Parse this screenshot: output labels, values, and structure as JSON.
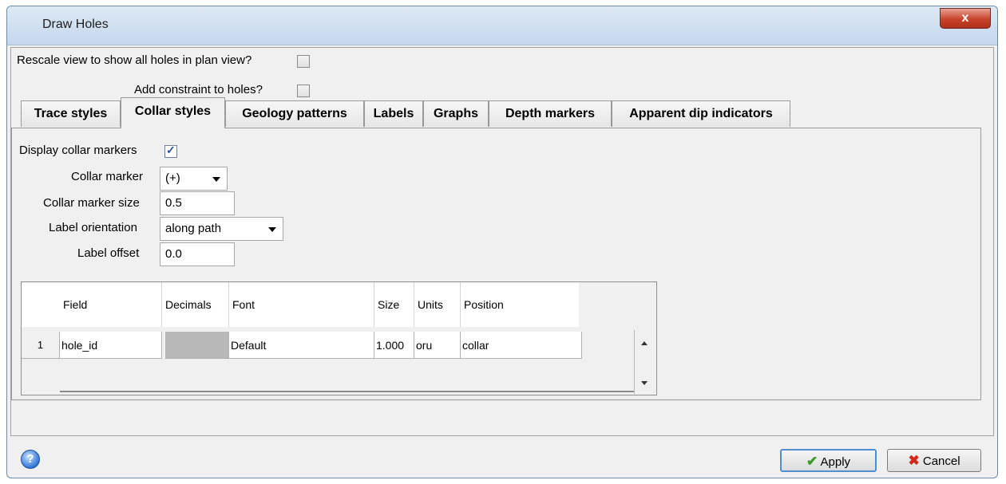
{
  "window": {
    "title": "Draw Holes",
    "close_glyph": "x"
  },
  "options": {
    "rescale_label": "Rescale view to show all holes in plan view?",
    "rescale_checked": false,
    "constraint_label": "Add constraint to holes?",
    "constraint_checked": false
  },
  "tabs": [
    {
      "label": "Trace styles",
      "active": false
    },
    {
      "label": "Collar styles",
      "active": true
    },
    {
      "label": "Geology patterns",
      "active": false
    },
    {
      "label": "Labels",
      "active": false
    },
    {
      "label": "Graphs",
      "active": false
    },
    {
      "label": "Depth markers",
      "active": false
    },
    {
      "label": "Apparent dip indicators",
      "active": false
    }
  ],
  "collar": {
    "display_label": "Display collar markers",
    "display_checked": true,
    "marker_label": "Collar marker",
    "marker_value": "(+)",
    "size_label": "Collar marker size",
    "size_value": "0.5",
    "orientation_label": "Label orientation",
    "orientation_value": "along path",
    "offset_label": "Label offset",
    "offset_value": "0.0"
  },
  "table": {
    "columns": [
      "Field",
      "Decimals",
      "Font",
      "Size",
      "Units",
      "Position"
    ],
    "rows": [
      {
        "num": "1",
        "field": "hole_id",
        "decimals": "",
        "font": "Default",
        "size": "1.000",
        "units": "oru",
        "position": "collar"
      }
    ]
  },
  "footer": {
    "help_glyph": "?",
    "apply_label": "Apply",
    "cancel_label": "Cancel"
  },
  "icons": {
    "help": "help-icon",
    "apply": "checkmark-icon",
    "cancel": "x-cancel-icon",
    "scroll_up": "arrow-up-icon",
    "scroll_down": "arrow-down-icon",
    "dropdown": "chevron-down-icon"
  }
}
